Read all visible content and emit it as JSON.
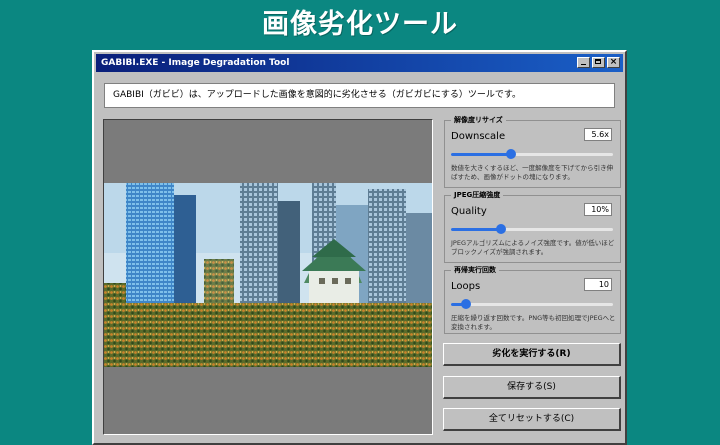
{
  "page_title": "画像劣化ツール",
  "window": {
    "title": "GABIBI.EXE - Image Degradation Tool",
    "controls": {
      "minimize": "_",
      "maximize": "□",
      "close": "×"
    }
  },
  "description": "GABIBI（ガビビ）は、アップロードした画像を意図的に劣化させる（ガビガビにする）ツールです。",
  "params": [
    {
      "group": "解像度リサイズ",
      "label": "Downscale",
      "value": "5.6x",
      "level": 0.37,
      "description": "数値を大きくするほど、一度解像度を下げてから引き伸ばすため、画像がドットの塊になります。"
    },
    {
      "group": "JPEG圧縮強度",
      "label": "Quality",
      "value": "10%",
      "level": 0.31,
      "description": "JPEGアルゴリズムによるノイズ強度です。値が低いほどブロックノイズが強調されます。"
    },
    {
      "group": "再帰実行回数",
      "label": "Loops",
      "value": "10",
      "level": 0.09,
      "description": "圧縮を繰り返す回数です。PNG等も初回処理でJPEGへと変換されます。"
    }
  ],
  "buttons": {
    "execute": "劣化を実行する(R)",
    "save": "保存する(S)",
    "reset": "全てリセットする(C)"
  },
  "colors": {
    "background": "#0b8781",
    "accent": "#2b6fe3",
    "titlebar": "#0a1f7a"
  }
}
